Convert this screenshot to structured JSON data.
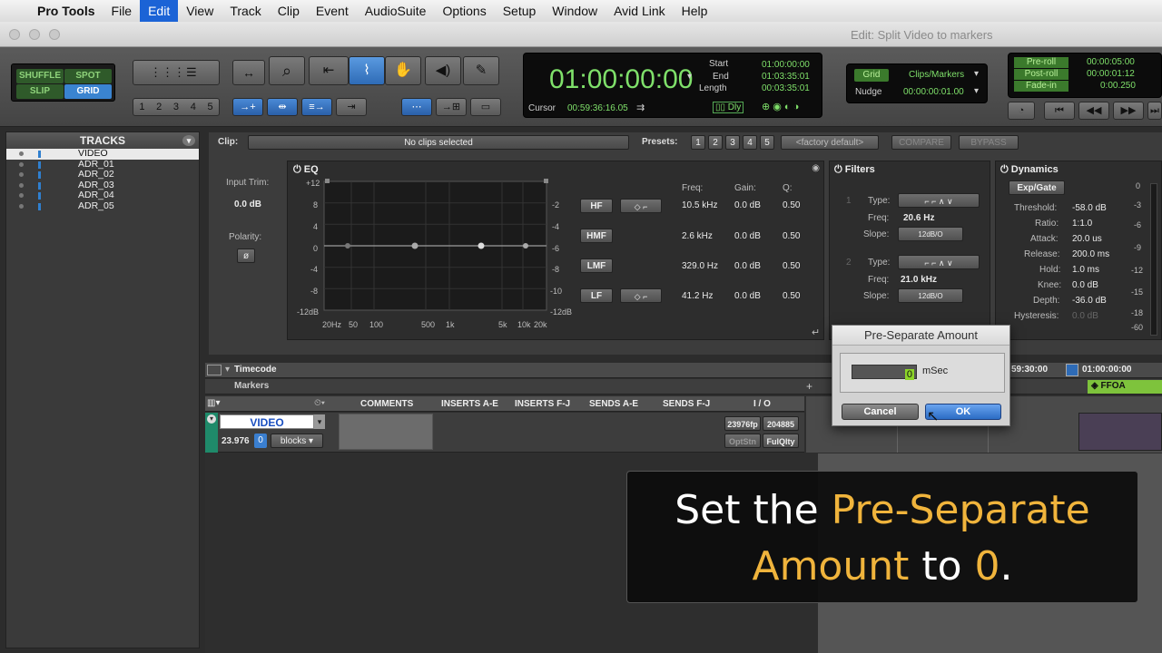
{
  "menubar": {
    "items": [
      "Pro Tools",
      "File",
      "Edit",
      "View",
      "Track",
      "Clip",
      "Event",
      "AudioSuite",
      "Options",
      "Setup",
      "Window",
      "Avid Link",
      "Help"
    ],
    "active": "Edit"
  },
  "window": {
    "title": "Edit: Split Video to markers"
  },
  "modes": {
    "shuffle": "SHUFFLE",
    "spot": "SPOT",
    "slip": "SLIP",
    "grid": "GRID"
  },
  "toolbar": {
    "zoom_presets": [
      "1",
      "2",
      "3",
      "4",
      "5"
    ]
  },
  "counter": {
    "main": "01:00:00:00",
    "start_label": "Start",
    "end_label": "End",
    "length_label": "Length",
    "start": "01:00:00:00",
    "end": "01:03:35:01",
    "length": "00:03:35:01",
    "cursor_label": "Cursor",
    "cursor": "00:59:36:16.05",
    "dly": "Dly"
  },
  "grid": {
    "grid_label": "Grid",
    "grid_value": "Clips/Markers",
    "nudge_label": "Nudge",
    "nudge_value": "00:00:00:01.00"
  },
  "transport": {
    "preroll_label": "Pre-roll",
    "preroll": "00:00:05:00",
    "postroll_label": "Post-roll",
    "postroll": "00:00:01:12",
    "fadein_label": "Fade-in",
    "fadein": "0:00.250"
  },
  "tracks": {
    "header": "TRACKS",
    "items": [
      {
        "name": "VIDEO"
      },
      {
        "name": "ADR_01"
      },
      {
        "name": "ADR_02"
      },
      {
        "name": "ADR_03"
      },
      {
        "name": "ADR_04"
      },
      {
        "name": "ADR_05"
      }
    ]
  },
  "clip": {
    "label": "Clip:",
    "value": "No clips selected",
    "presets_label": "Presets:",
    "presets": [
      "1",
      "2",
      "3",
      "4",
      "5"
    ],
    "factory": "<factory default>",
    "compare": "COMPARE",
    "bypass": "BYPASS"
  },
  "input": {
    "trim_label": "Input Trim:",
    "trim_value": "0.0 dB",
    "polarity_label": "Polarity:"
  },
  "eq": {
    "title": "EQ",
    "y_left": [
      "+12",
      "8",
      "4",
      "0",
      "-4",
      "-8",
      "-12dB"
    ],
    "y_right": [
      "-2",
      "-4",
      "-6",
      "-8",
      "-10",
      "-12dB"
    ],
    "x_ticks": [
      "20Hz",
      "50",
      "100",
      "500",
      "1k",
      "5k",
      "10k",
      "20k"
    ],
    "col_freq": "Freq:",
    "col_gain": "Gain:",
    "col_q": "Q:",
    "bands": [
      {
        "name": "HF",
        "freq": "10.5 kHz",
        "gain": "0.0 dB",
        "q": "0.50"
      },
      {
        "name": "HMF",
        "freq": "2.6 kHz",
        "gain": "0.0 dB",
        "q": "0.50"
      },
      {
        "name": "LMF",
        "freq": "329.0 Hz",
        "gain": "0.0 dB",
        "q": "0.50"
      },
      {
        "name": "LF",
        "freq": "41.2 Hz",
        "gain": "0.0 dB",
        "q": "0.50"
      }
    ]
  },
  "filters": {
    "title": "Filters",
    "f1": {
      "num": "1",
      "type_label": "Type:",
      "freq_label": "Freq:",
      "freq": "20.6 Hz",
      "slope_label": "Slope:",
      "slope": "12dB/O"
    },
    "f2": {
      "num": "2",
      "type_label": "Type:",
      "freq_label": "Freq:",
      "freq": "21.0 kHz",
      "slope_label": "Slope:",
      "slope": "12dB/O"
    }
  },
  "dynamics": {
    "title": "Dynamics",
    "mode": "Exp/Gate",
    "params": [
      {
        "label": "Threshold:",
        "value": "-58.0 dB"
      },
      {
        "label": "Ratio:",
        "value": "1:1.0"
      },
      {
        "label": "Attack:",
        "value": "20.0 us"
      },
      {
        "label": "Release:",
        "value": "200.0 ms"
      },
      {
        "label": "Hold:",
        "value": "1.0 ms"
      },
      {
        "label": "Knee:",
        "value": "0.0 dB"
      },
      {
        "label": "Depth:",
        "value": "-36.0 dB"
      },
      {
        "label": "Hysteresis:",
        "value": "0.0 dB"
      }
    ],
    "meter": [
      "0",
      "-3",
      "-6",
      "-9",
      "-12",
      "-15",
      "-18",
      "-60"
    ]
  },
  "rulers": {
    "timecode": "Timecode",
    "markers": "Markers",
    "tc1": "59:30:00",
    "tc2": "01:00:00:00",
    "ffoa": "FFOA"
  },
  "mixcols": {
    "comments": "COMMENTS",
    "ins_ae": "INSERTS A-E",
    "ins_fj": "INSERTS F-J",
    "sends_ae": "SENDS A-E",
    "sends_fj": "SENDS F-J",
    "io": "I / O"
  },
  "videotrack": {
    "name": "VIDEO",
    "rate": "23.976",
    "zero": "0",
    "view": "blocks",
    "io": [
      "23976fp",
      "204885",
      "OptStn",
      "FulQlty"
    ]
  },
  "dialog": {
    "title": "Pre-Separate Amount",
    "value": "0",
    "unit": "mSec",
    "cancel": "Cancel",
    "ok": "OK"
  },
  "caption": {
    "p1": "Set the ",
    "h1": "Pre-Separate",
    "h2": "Amount",
    "p2": " to ",
    "h3": "0",
    "p3": "."
  }
}
